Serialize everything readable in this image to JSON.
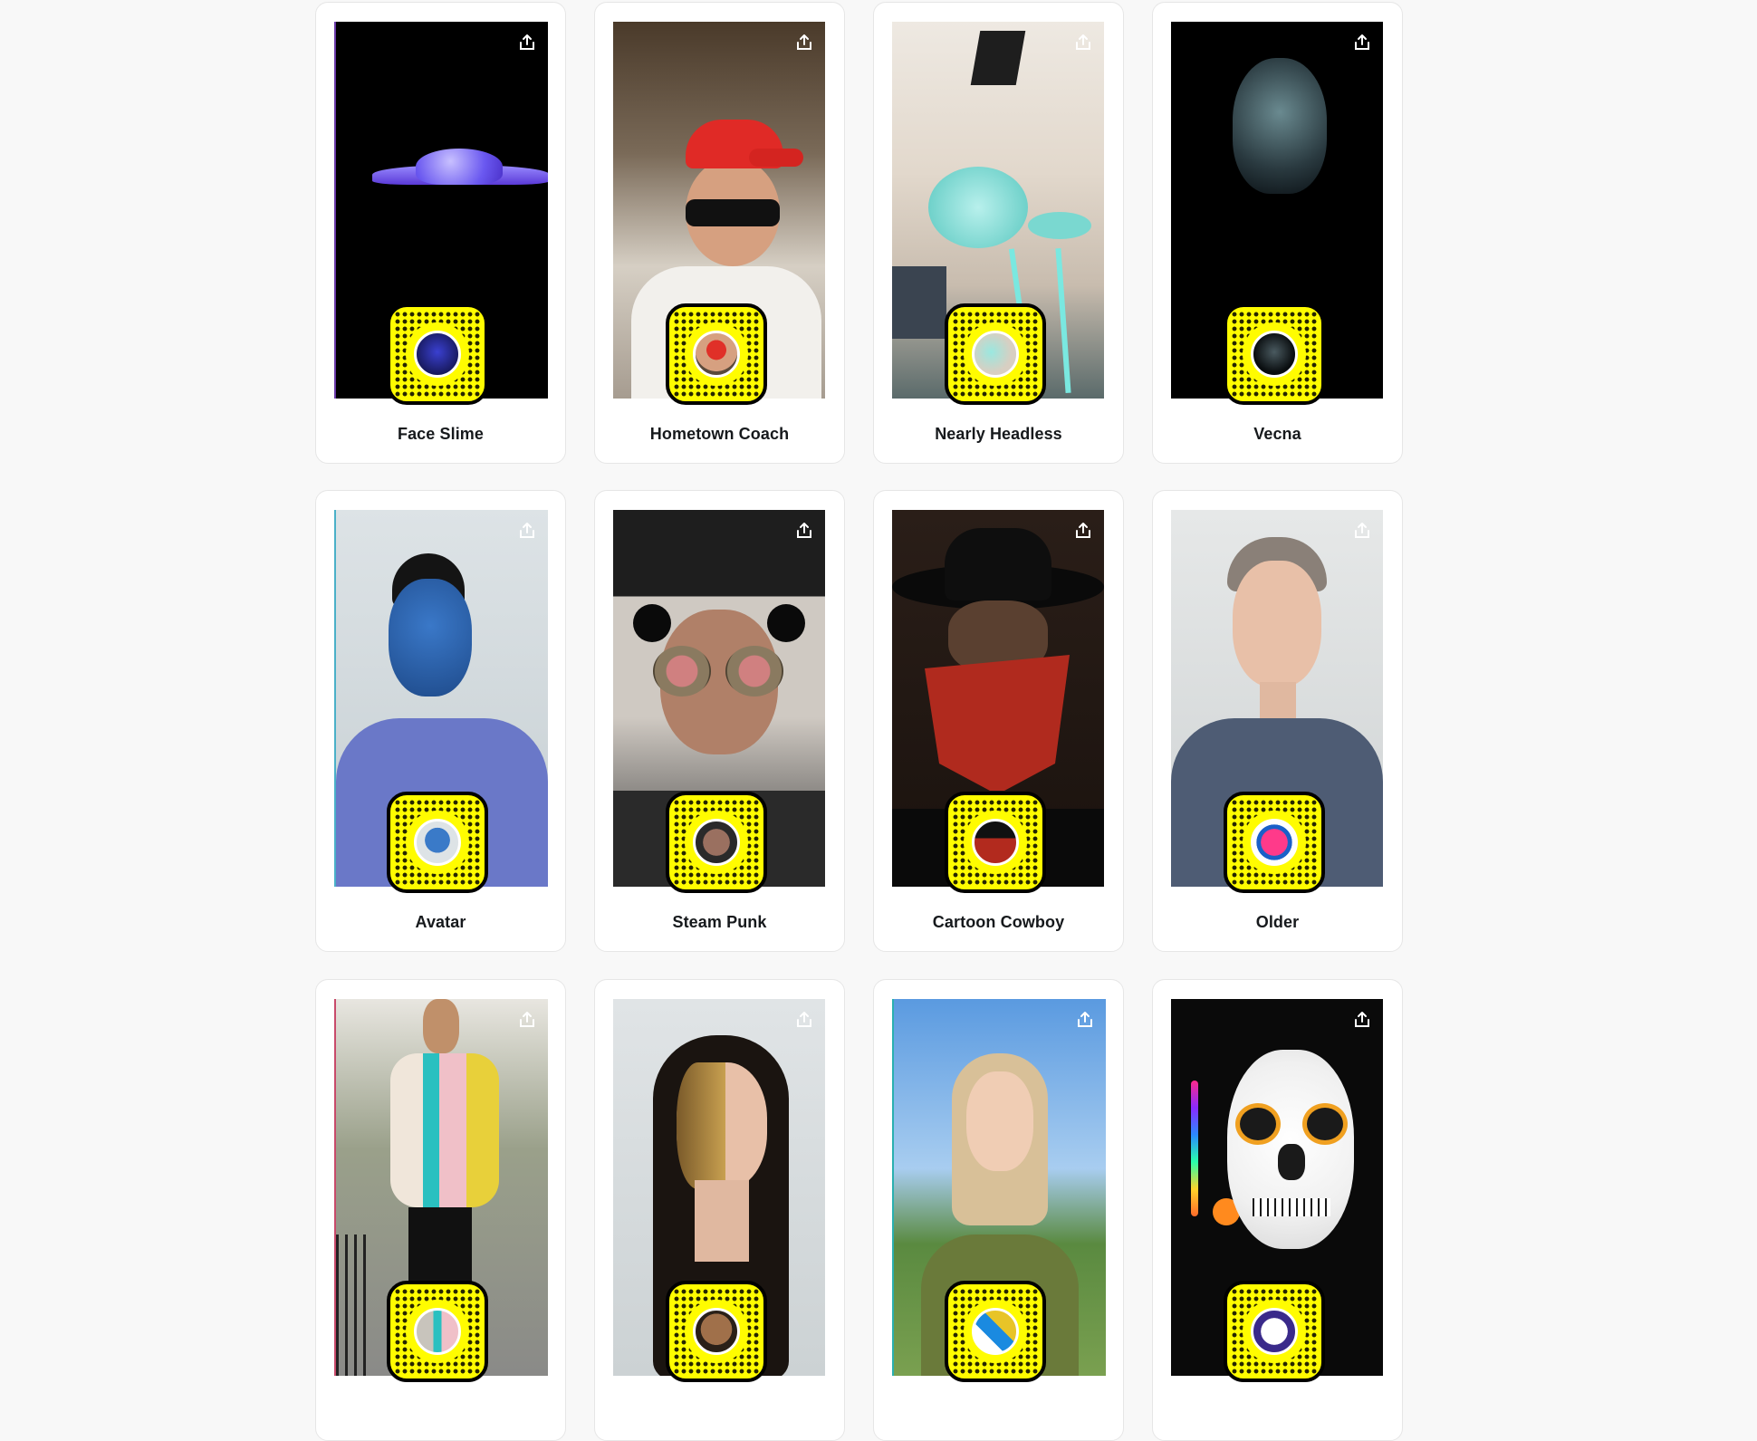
{
  "cards": [
    {
      "title": "Face Slime",
      "share_icon": "share-icon",
      "thumb_color": "#2a2fa0"
    },
    {
      "title": "Hometown Coach",
      "share_icon": "share-icon",
      "thumb_color": "#c9342c"
    },
    {
      "title": "Nearly Headless",
      "share_icon": "share-icon",
      "thumb_color": "#7fd6d0"
    },
    {
      "title": "Vecna",
      "share_icon": "share-icon",
      "thumb_color": "#1d2a30"
    },
    {
      "title": "Avatar",
      "share_icon": "share-icon",
      "thumb_color": "#2a5a9a"
    },
    {
      "title": "Steam Punk",
      "share_icon": "share-icon",
      "thumb_color": "#6a4a3a"
    },
    {
      "title": "Cartoon Cowboy",
      "share_icon": "share-icon",
      "thumb_color": "#b22a1e"
    },
    {
      "title": "Older",
      "share_icon": "share-icon",
      "thumb_color": "#e8306a"
    },
    {
      "title": "",
      "share_icon": "share-icon",
      "thumb_color": "#c8c4bc"
    },
    {
      "title": "",
      "share_icon": "share-icon",
      "thumb_color": "#a0704a"
    },
    {
      "title": "",
      "share_icon": "share-icon",
      "thumb_color": "#e8c428"
    },
    {
      "title": "",
      "share_icon": "share-icon",
      "thumb_color": "#ffffff"
    }
  ]
}
